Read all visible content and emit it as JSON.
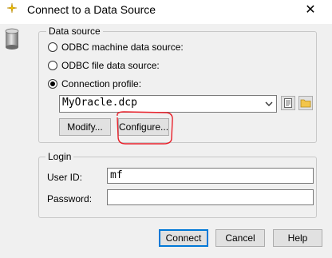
{
  "window": {
    "title": "Connect to a Data Source",
    "close_glyph": "✕"
  },
  "data_source": {
    "legend": "Data source",
    "options": [
      {
        "label": "ODBC machine data source:",
        "checked": false
      },
      {
        "label": "ODBC file data source:",
        "checked": false
      },
      {
        "label": "Connection profile:",
        "checked": true
      }
    ],
    "profile_value": "MyOracle.dcp",
    "modify_label": "Modify...",
    "configure_label": "Configure..."
  },
  "login": {
    "legend": "Login",
    "user_id_label": "User ID:",
    "user_id_value": "mf",
    "password_label": "Password:",
    "password_value": ""
  },
  "buttons": {
    "connect": "Connect",
    "cancel": "Cancel",
    "help": "Help"
  },
  "icons": {
    "app": "database-sparkle-icon",
    "data_source": "database-cylinder-icon",
    "new_profile": "new-document-icon",
    "browse": "folder-icon",
    "dropdown": "chevron-down-icon"
  },
  "colors": {
    "accent": "#0078d7",
    "annotation": "#e8202a"
  }
}
